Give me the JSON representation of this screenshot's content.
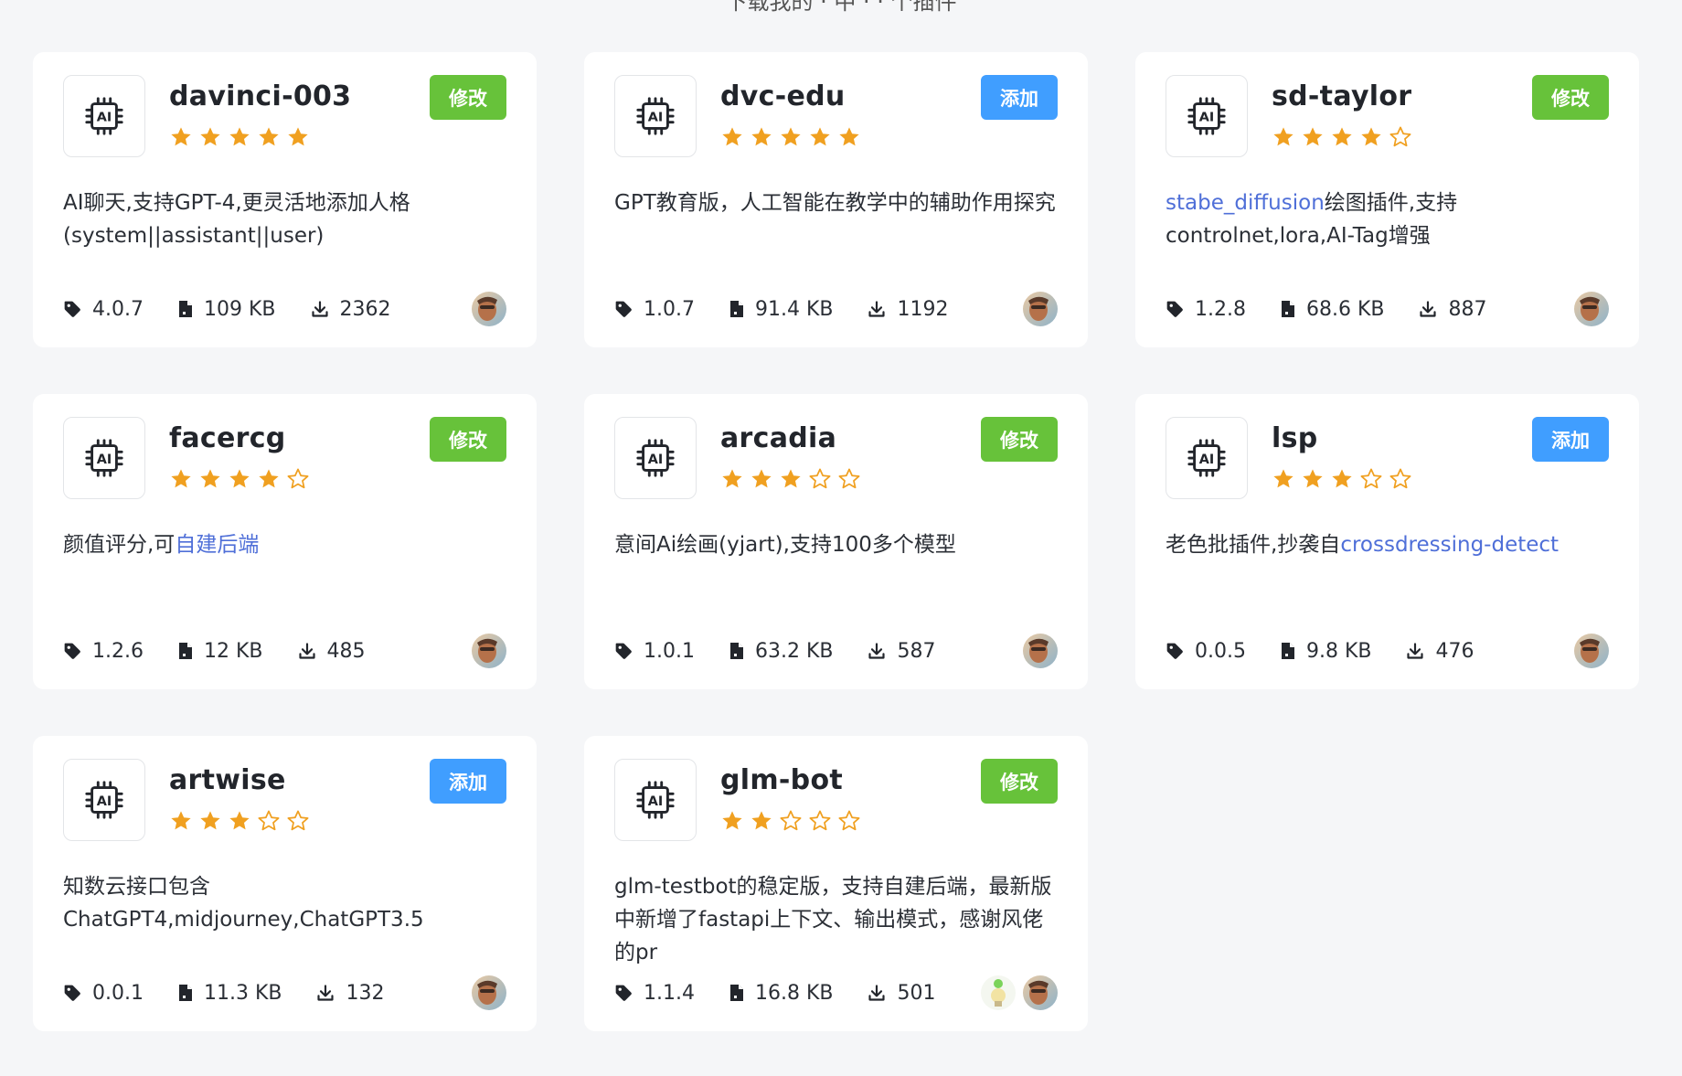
{
  "page": {
    "top_partial_text": "下载我的 · 中 · · 个插件"
  },
  "colors": {
    "green": "#67c23a",
    "blue": "#409eff",
    "star": "#f0a020",
    "link": "#4f6fd8"
  },
  "plugins": [
    {
      "name": "davinci-003",
      "rating": 5,
      "action": "修改",
      "action_style": "green",
      "desc_parts": [
        {
          "text": "AI聊天,支持GPT-4,更灵活地添加人格(system||assistant||user)",
          "link": false
        }
      ],
      "version": "4.0.7",
      "size": "109 KB",
      "downloads": "2362",
      "avatars": [
        "author"
      ]
    },
    {
      "name": "dvc-edu",
      "rating": 5,
      "action": "添加",
      "action_style": "blue",
      "desc_parts": [
        {
          "text": "GPT教育版，人工智能在教学中的辅助作用探究",
          "link": false
        }
      ],
      "version": "1.0.7",
      "size": "91.4 KB",
      "downloads": "1192",
      "avatars": [
        "author"
      ]
    },
    {
      "name": "sd-taylor",
      "rating": 4,
      "action": "修改",
      "action_style": "green",
      "desc_parts": [
        {
          "text": "stabe_diffusion",
          "link": true
        },
        {
          "text": "绘图插件,支持controlnet,lora,AI-Tag增强",
          "link": false
        }
      ],
      "version": "1.2.8",
      "size": "68.6 KB",
      "downloads": "887",
      "avatars": [
        "author"
      ]
    },
    {
      "name": "facercg",
      "rating": 4,
      "action": "修改",
      "action_style": "green",
      "desc_parts": [
        {
          "text": "颜值评分,可",
          "link": false
        },
        {
          "text": "自建后端",
          "link": true
        }
      ],
      "version": "1.2.6",
      "size": "12 KB",
      "downloads": "485",
      "avatars": [
        "author"
      ]
    },
    {
      "name": "arcadia",
      "rating": 3,
      "action": "修改",
      "action_style": "green",
      "desc_parts": [
        {
          "text": "意间Ai绘画(yjart),支持100多个模型",
          "link": false
        }
      ],
      "version": "1.0.1",
      "size": "63.2 KB",
      "downloads": "587",
      "avatars": [
        "author"
      ]
    },
    {
      "name": "lsp",
      "rating": 3,
      "action": "添加",
      "action_style": "blue",
      "desc_parts": [
        {
          "text": "老色批插件,抄袭自",
          "link": false
        },
        {
          "text": "crossdressing-detect",
          "link": true
        }
      ],
      "version": "0.0.5",
      "size": "9.8 KB",
      "downloads": "476",
      "avatars": [
        "author"
      ]
    },
    {
      "name": "artwise",
      "rating": 3,
      "action": "添加",
      "action_style": "blue",
      "desc_parts": [
        {
          "text": "知数云接口包含ChatGPT4,midjourney,ChatGPT3.5",
          "link": false
        }
      ],
      "version": "0.0.1",
      "size": "11.3 KB",
      "downloads": "132",
      "avatars": [
        "author"
      ]
    },
    {
      "name": "glm-bot",
      "rating": 2,
      "action": "修改",
      "action_style": "green",
      "desc_parts": [
        {
          "text": "glm-testbot的稳定版，支持自建后端，最新版中新增了fastapi上下文、输出模式，感谢风佬的pr",
          "link": false
        }
      ],
      "version": "1.1.4",
      "size": "16.8 KB",
      "downloads": "501",
      "avatars": [
        "contributor",
        "author"
      ]
    }
  ]
}
